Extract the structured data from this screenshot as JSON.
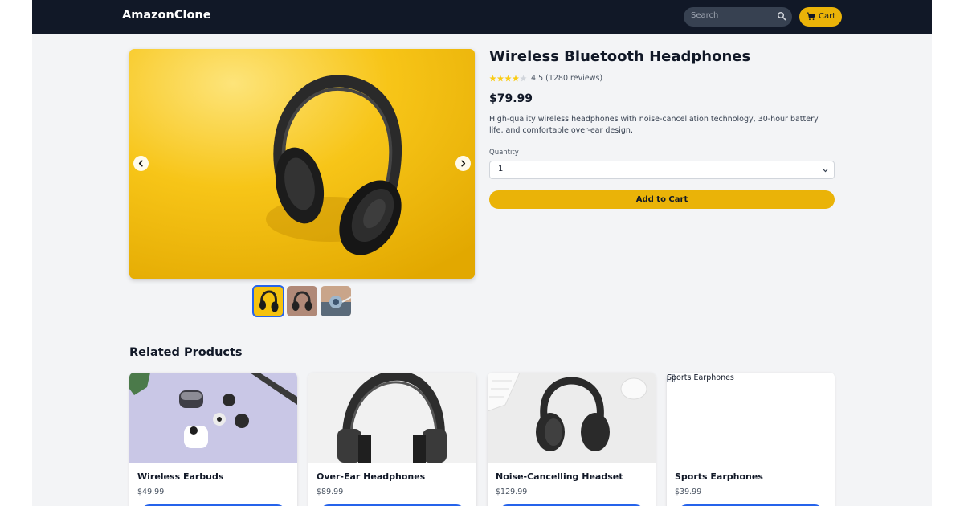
{
  "header": {
    "brand": "AmazonClone",
    "search_placeholder": "Search",
    "cart_label": "Cart"
  },
  "product": {
    "title": "Wireless Bluetooth Headphones",
    "rating": 4.5,
    "rating_text": "4.5 (1280 reviews)",
    "price": "$79.99",
    "description": "High-quality wireless headphones with noise-cancellation technology, 30-hour battery life, and comfortable over-ear design.",
    "quantity_label": "Quantity",
    "quantity_value": "1",
    "add_to_cart_label": "Add to Cart"
  },
  "related": {
    "heading": "Related Products",
    "items": [
      {
        "name": "Wireless Earbuds",
        "price": "$49.99"
      },
      {
        "name": "Over-Ear Headphones",
        "price": "$89.99"
      },
      {
        "name": "Noise-Cancelling Headset",
        "price": "$129.99"
      },
      {
        "name": "Sports Earphones",
        "price": "$39.99",
        "alt": "Sports Earphones"
      }
    ]
  },
  "colors": {
    "navbar": "#111827",
    "accent": "#eab308",
    "button_blue": "#2563eb",
    "background": "#f3f4f6"
  },
  "icons": [
    "search-icon",
    "cart-icon",
    "chevron-left-icon",
    "chevron-right-icon",
    "chevron-down-icon",
    "star-icon",
    "broken-image-icon"
  ]
}
